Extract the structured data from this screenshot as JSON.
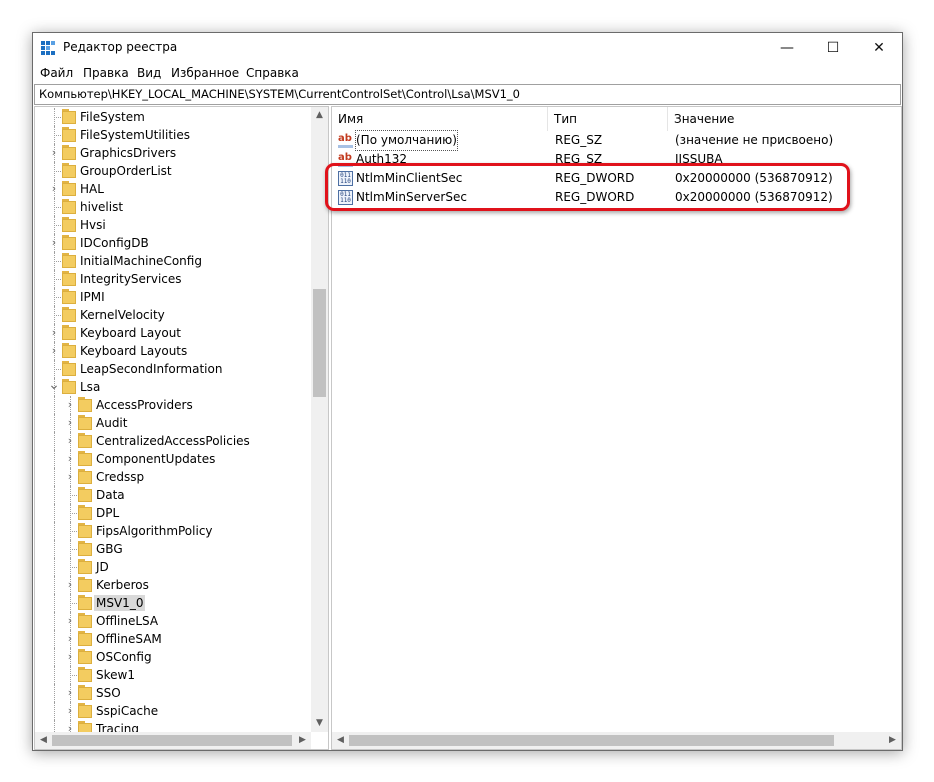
{
  "window": {
    "title": "Редактор реестра"
  },
  "title_buttons": {
    "minimize": "—",
    "maximize": "☐",
    "close": "✕"
  },
  "menu": [
    "Файл",
    "Правка",
    "Вид",
    "Избранное",
    "Справка"
  ],
  "address": "Компьютер\\HKEY_LOCAL_MACHINE\\SYSTEM\\CurrentControlSet\\Control\\Lsa\\MSV1_0",
  "tree": [
    {
      "label": "FileSystem",
      "expandable": false,
      "level": 1
    },
    {
      "label": "FileSystemUtilities",
      "expandable": false,
      "level": 1
    },
    {
      "label": "GraphicsDrivers",
      "expandable": true,
      "level": 1
    },
    {
      "label": "GroupOrderList",
      "expandable": false,
      "level": 1
    },
    {
      "label": "HAL",
      "expandable": true,
      "level": 1
    },
    {
      "label": "hivelist",
      "expandable": false,
      "level": 1
    },
    {
      "label": "Hvsi",
      "expandable": false,
      "level": 1
    },
    {
      "label": "IDConfigDB",
      "expandable": true,
      "level": 1
    },
    {
      "label": "InitialMachineConfig",
      "expandable": false,
      "level": 1
    },
    {
      "label": "IntegrityServices",
      "expandable": false,
      "level": 1
    },
    {
      "label": "IPMI",
      "expandable": false,
      "level": 1
    },
    {
      "label": "KernelVelocity",
      "expandable": false,
      "level": 1
    },
    {
      "label": "Keyboard Layout",
      "expandable": true,
      "level": 1
    },
    {
      "label": "Keyboard Layouts",
      "expandable": true,
      "level": 1
    },
    {
      "label": "LeapSecondInformation",
      "expandable": false,
      "level": 1
    },
    {
      "label": "Lsa",
      "expandable": true,
      "expanded": true,
      "level": 1
    },
    {
      "label": "AccessProviders",
      "expandable": true,
      "level": 2
    },
    {
      "label": "Audit",
      "expandable": true,
      "level": 2
    },
    {
      "label": "CentralizedAccessPolicies",
      "expandable": true,
      "level": 2
    },
    {
      "label": "ComponentUpdates",
      "expandable": true,
      "level": 2
    },
    {
      "label": "Credssp",
      "expandable": true,
      "level": 2
    },
    {
      "label": "Data",
      "expandable": false,
      "level": 2
    },
    {
      "label": "DPL",
      "expandable": false,
      "level": 2
    },
    {
      "label": "FipsAlgorithmPolicy",
      "expandable": false,
      "level": 2
    },
    {
      "label": "GBG",
      "expandable": false,
      "level": 2
    },
    {
      "label": "JD",
      "expandable": false,
      "level": 2
    },
    {
      "label": "Kerberos",
      "expandable": true,
      "level": 2
    },
    {
      "label": "MSV1_0",
      "expandable": false,
      "level": 2,
      "selected": true
    },
    {
      "label": "OfflineLSA",
      "expandable": true,
      "level": 2
    },
    {
      "label": "OfflineSAM",
      "expandable": true,
      "level": 2
    },
    {
      "label": "OSConfig",
      "expandable": true,
      "level": 2
    },
    {
      "label": "Skew1",
      "expandable": false,
      "level": 2
    },
    {
      "label": "SSO",
      "expandable": true,
      "level": 2
    },
    {
      "label": "SspiCache",
      "expandable": true,
      "level": 2
    },
    {
      "label": "Tracing",
      "expandable": true,
      "level": 2
    }
  ],
  "list": {
    "columns": [
      "Имя",
      "Тип",
      "Значение"
    ],
    "rows": [
      {
        "icon": "string-value-icon",
        "name": "(По умолчанию)",
        "type": "REG_SZ",
        "value": "(значение не присвоено)"
      },
      {
        "icon": "string-value-icon",
        "name": "Auth132",
        "type": "REG_SZ",
        "value": "IISSUBA"
      },
      {
        "icon": "binary-value-icon",
        "name": "NtlmMinClientSec",
        "type": "REG_DWORD",
        "value": "0x20000000 (536870912)"
      },
      {
        "icon": "binary-value-icon",
        "name": "NtlmMinServerSec",
        "type": "REG_DWORD",
        "value": "0x20000000 (536870912)"
      }
    ]
  },
  "scroll_arrows": {
    "up": "▲",
    "down": "▼",
    "left": "◀",
    "right": "▶"
  },
  "colors": {
    "highlight": "#e0121b",
    "folder": "#f3cc60",
    "icon_blue": "#1c6fc1"
  }
}
